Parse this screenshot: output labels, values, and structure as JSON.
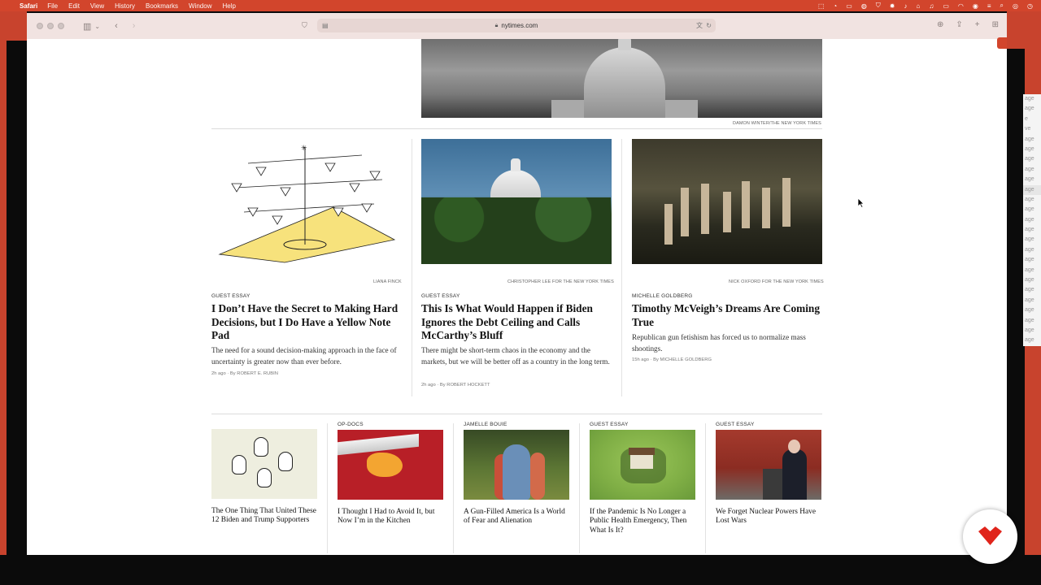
{
  "menubar": {
    "app": "Safari",
    "items": [
      "File",
      "Edit",
      "View",
      "History",
      "Bookmarks",
      "Window",
      "Help"
    ]
  },
  "browser": {
    "url": "nytimes.com"
  },
  "hero": {
    "credit": "DAMON WINTER/THE NEW YORK TIMES"
  },
  "top_articles": [
    {
      "credit": "LIANA FINCK",
      "kicker": "GUEST ESSAY",
      "headline": "I Don’t Have the Secret to Making Hard Decisions, but I Do Have a Yellow Note Pad",
      "summary": "The need for a sound decision-making approach in the face of uncertainty is greater now than ever before.",
      "time": "2h ago",
      "byline": "By ROBERT E. RUBIN"
    },
    {
      "credit": "CHRISTOPHER LEE FOR THE NEW YORK TIMES",
      "kicker": "GUEST ESSAY",
      "headline": "This Is What Would Happen if Biden Ignores the Debt Ceiling and Calls McCarthy’s Bluff",
      "summary": "There might be short-term chaos in the economy and the markets, but we will be better off as a country in the long term.",
      "time": "2h ago",
      "byline": "By ROBERT HOCKETT"
    },
    {
      "credit": "NICK OXFORD FOR THE NEW YORK TIMES",
      "kicker": "MICHELLE GOLDBERG",
      "headline": "Timothy McVeigh’s Dreams Are Coming True",
      "summary": "Republican gun fetishism has forced us to normalize mass shootings.",
      "time": "15h ago",
      "byline": "By MICHELLE GOLDBERG"
    }
  ],
  "small_articles": [
    {
      "kicker": "",
      "title": "The One Thing That United These 12 Biden and Trump Supporters"
    },
    {
      "kicker": "OP-DOCS",
      "title": "I Thought I Had to Avoid It, but Now I’m in the Kitchen"
    },
    {
      "kicker": "JAMELLE BOUIE",
      "title": "A Gun-Filled America Is a World of Fear and Alienation"
    },
    {
      "kicker": "GUEST ESSAY",
      "title": "If the Pandemic Is No Longer a Public Health Emergency, Then What Is It?"
    },
    {
      "kicker": "GUEST ESSAY",
      "title": "We Forget Nuclear Powers Have Lost Wars"
    }
  ],
  "background_window_lines": [
    "age",
    "age",
    "e",
    "ve",
    "age",
    "age",
    "age",
    "age",
    "age",
    "age",
    "age",
    "age",
    "age",
    "age",
    "age",
    "age",
    "age",
    "age",
    "age",
    "age",
    "age",
    "age",
    "age",
    "age",
    "age"
  ],
  "colors": {
    "menubar": "#d2452c",
    "toolbar": "#f1e3e1",
    "logo_red": "#e0241b"
  },
  "icons": {
    "apple": "apple-icon",
    "reader": "page-icon",
    "lock": "lock-icon",
    "logo": "red-heart-logo"
  }
}
